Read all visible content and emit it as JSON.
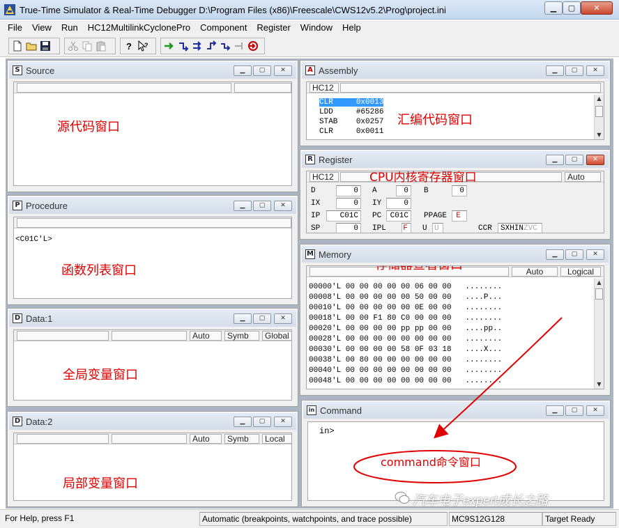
{
  "titlebar": {
    "title": "True-Time Simulator & Real-Time Debugger   D:\\Program Files (x86)\\Freescale\\CWS12v5.2\\Prog\\project.ini",
    "min_glyph": "▁",
    "max_glyph": "▢",
    "close_glyph": "✕"
  },
  "menu": [
    "File",
    "View",
    "Run",
    "HC12MultilinkCyclonePro",
    "Component",
    "Register",
    "Window",
    "Help"
  ],
  "toolbar": {
    "icons": [
      "new-file-icon",
      "open-folder-icon",
      "save-icon",
      "cut-icon",
      "copy-icon",
      "paste-icon",
      "help-icon",
      "context-help-icon",
      "start-icon",
      "single-step-icon",
      "step-over-icon",
      "step-out-icon",
      "assembly-step-icon",
      "halt-icon",
      "reset-icon"
    ]
  },
  "window_buttons": {
    "min": "▁",
    "max": "▢",
    "close": "✕"
  },
  "source": {
    "title": "Source",
    "icon": "S",
    "annotation": "源代码窗口"
  },
  "procedure": {
    "title": "Procedure",
    "icon": "P",
    "entry": "<C01C'L>",
    "annotation": "函数列表窗口"
  },
  "data1": {
    "title": "Data:1",
    "icon": "D",
    "cols": [
      "Auto",
      "Symb",
      "Global"
    ],
    "annotation": "全局变量窗口"
  },
  "data2": {
    "title": "Data:2",
    "icon": "D",
    "cols": [
      "Auto",
      "Symb",
      "Local"
    ],
    "annotation": "局部变量窗口"
  },
  "assembly": {
    "title": "Assembly",
    "icon": "A",
    "cpu": "HC12",
    "annotation": "汇编代码窗口",
    "lines": [
      {
        "op": "CLR",
        "arg": "0x0013"
      },
      {
        "op": "LDD",
        "arg": "#65286"
      },
      {
        "op": "STAB",
        "arg": "0x0257"
      },
      {
        "op": "CLR",
        "arg": "0x0011"
      }
    ]
  },
  "register": {
    "title": "Register",
    "icon": "R",
    "cpu": "HC12",
    "mode": "Auto",
    "annotation": "CPU内核寄存器窗口",
    "labels": {
      "d": "D",
      "a": "A",
      "b": "B",
      "ix": "IX",
      "iy": "IY",
      "ip": "IP",
      "pc": "PC",
      "ppage": "PPAGE",
      "sp": "SP",
      "ipl": "IPL",
      "u": "U",
      "ccr": "CCR"
    },
    "values": {
      "d": "0",
      "a": "0",
      "b": "0",
      "ix": "0",
      "iy": "0",
      "ip": "C01C",
      "pc": "C01C",
      "ppage": "E",
      "sp": "0",
      "ipl": "F",
      "u": "U",
      "ccr_active": "SXHIN",
      "ccr_inactive": "ZVC"
    }
  },
  "memory": {
    "title": "Memory",
    "icon": "M",
    "mode": "Auto",
    "view": "Logical",
    "annotation": "存储器查看窗口",
    "rows": [
      "00000'L 00 00 00 00 00 06 00 00   ........",
      "00008'L 00 00 00 00 00 50 00 00   ....P...",
      "00010'L 00 00 00 00 00 0E 00 00   ........",
      "00018'L 00 00 F1 80 C0 00 00 00   ........",
      "00020'L 00 00 00 00 pp pp 00 00   ....pp..",
      "00028'L 00 00 00 00 00 00 00 00   ........",
      "00030'L 00 00 00 00 58 0F 03 18   ....X...",
      "00038'L 00 80 00 00 00 00 00 00   ........",
      "00040'L 00 00 00 00 00 00 00 00   ........",
      "00048'L 00 00 00 00 00 00 00 00   ........"
    ]
  },
  "command": {
    "title": "Command",
    "icon": "in",
    "prompt": "in>",
    "annotation": "command命令窗口"
  },
  "statusbar": {
    "help": "For Help, press F1",
    "mode": "Automatic (breakpoints, watchpoints, and trace possible)",
    "chip": "MC9S12G128",
    "state": "Target Ready"
  },
  "watermark": "汽车电子expert成长之路",
  "colors": {
    "annotation": "#e00000",
    "selection": "#3399ff",
    "mdi_background": "#abb6c4"
  }
}
